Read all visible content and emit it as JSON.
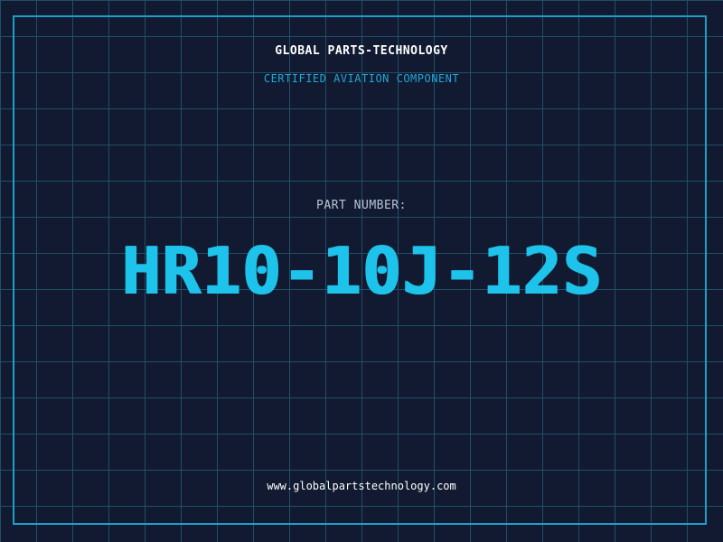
{
  "header": {
    "company": "GLOBAL PARTS-TECHNOLOGY",
    "subtitle": "CERTIFIED AVIATION COMPONENT"
  },
  "part": {
    "label": "PART NUMBER:",
    "number": "HR10-10J-12S"
  },
  "footer": {
    "website": "www.globalpartstechnology.com"
  },
  "colors": {
    "background": "#111a30",
    "grid": "#1f4f68",
    "accent": "#1ec3ec",
    "border": "#1aa0c8"
  }
}
